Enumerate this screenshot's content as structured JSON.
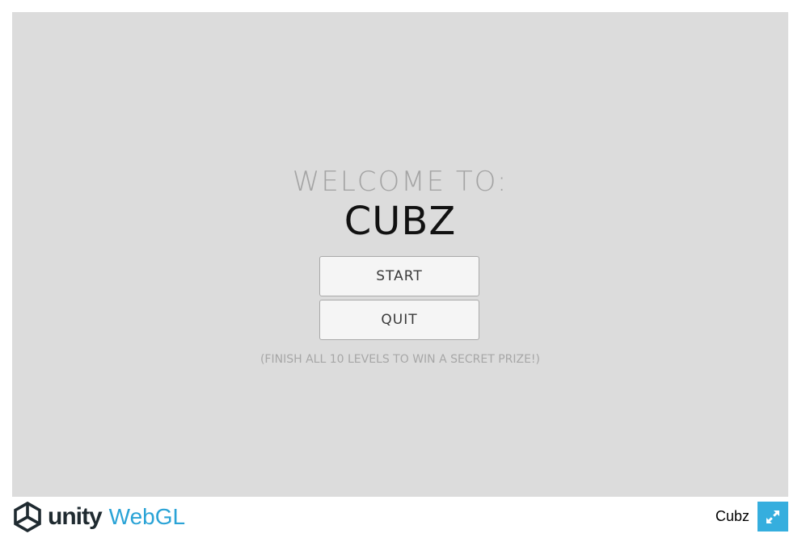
{
  "game": {
    "welcome_text": "WELCOME TO:",
    "title": "CUBZ",
    "start_label": "START",
    "quit_label": "QUIT",
    "hint_text": "(FINISH ALL 10 LEVELS TO WIN A SECRET PRIZE!)"
  },
  "footer": {
    "logo_unity": "unity",
    "logo_webgl": "WebGL",
    "game_name": "Cubz",
    "fullscreen_icon": "fullscreen-icon"
  },
  "colors": {
    "canvas_bg": "#dcdcdc",
    "accent": "#35aede",
    "webgl_text": "#2aa3d6"
  }
}
